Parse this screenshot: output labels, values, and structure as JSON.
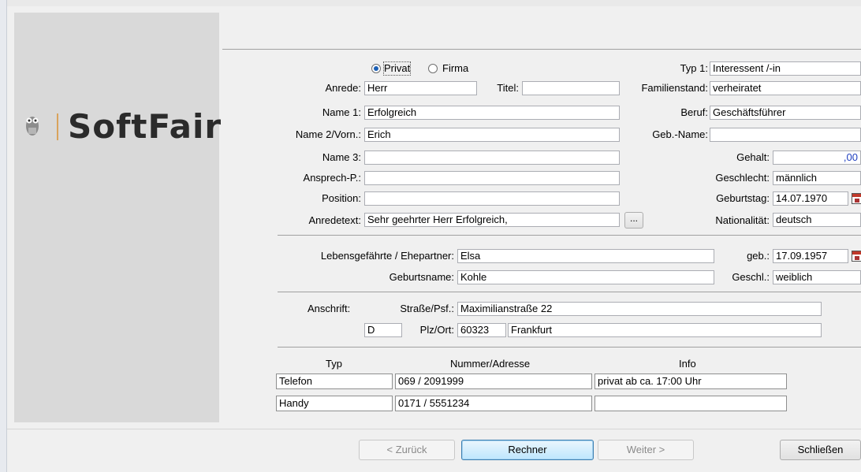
{
  "logo": {
    "brand": "SoftFair"
  },
  "person_type": {
    "privat": "Privat",
    "firma": "Firma",
    "selected": "Privat"
  },
  "labels": {
    "anrede": "Anrede:",
    "titel": "Titel:",
    "name1": "Name 1:",
    "name2": "Name 2/Vorn.:",
    "name3": "Name 3:",
    "ansprech": "Ansprech-P.:",
    "position": "Position:",
    "anredetext": "Anredetext:",
    "typ1": "Typ 1:",
    "familienstand": "Familienstand:",
    "beruf": "Beruf:",
    "gebname": "Geb.-Name:",
    "gehalt": "Gehalt:",
    "geschlecht": "Geschlecht:",
    "geburtstag": "Geburtstag:",
    "nationalitaet": "Nationalität:",
    "partner": "Lebensgefährte / Ehepartner:",
    "geburtsname": "Geburtsname:",
    "partner_geb": "geb.:",
    "geschl": "Geschl.:",
    "anschrift": "Anschrift:",
    "strasse": "Straße/Psf.:",
    "plzort": "Plz/Ort:"
  },
  "fields": {
    "anrede": "Herr",
    "titel": "",
    "name1": "Erfolgreich",
    "name2": "Erich",
    "name3": "",
    "ansprech": "",
    "position": "",
    "anredetext": "Sehr geehrter Herr Erfolgreich,",
    "typ1": "Interessent /-in",
    "familienstand": "verheiratet",
    "beruf": "Geschäftsführer",
    "gebname": "",
    "gehalt": ",00",
    "geschlecht": "männlich",
    "geburtstag": "14.07.1970",
    "nationalitaet": "deutsch"
  },
  "ellipsis_button": "...",
  "partner": {
    "name": "Elsa",
    "geburtsname": "Kohle",
    "geb": "17.09.1957",
    "geschl": "weiblich"
  },
  "address": {
    "strasse": "Maximilianstraße 22",
    "land": "D",
    "plz": "60323",
    "ort": "Frankfurt"
  },
  "contacts": {
    "headers": [
      "Typ",
      "Nummer/Adresse",
      "Info"
    ],
    "rows": [
      [
        "Telefon",
        "069 / 2091999",
        "privat ab ca. 17:00 Uhr"
      ],
      [
        "Handy",
        "0171 / 5551234",
        ""
      ]
    ]
  },
  "buttons": {
    "zurueck": "< Zurück",
    "rechner": "Rechner",
    "weiter": "Weiter >",
    "schliessen": "Schließen"
  }
}
